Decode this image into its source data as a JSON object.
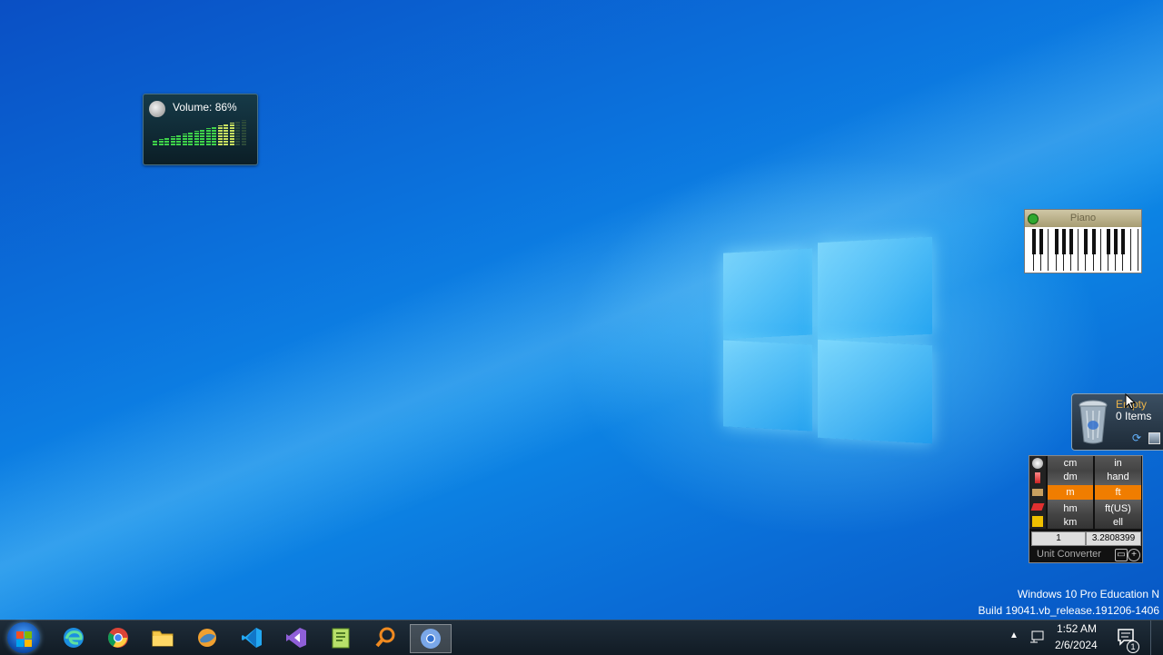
{
  "desktop": {
    "watermark": {
      "edition": "Windows 10 Pro Education N",
      "build": "Build 19041.vb_release.191206-1406"
    }
  },
  "volume_gadget": {
    "label": "Volume: 86%",
    "level_percent": 86
  },
  "piano_gadget": {
    "title": "Piano"
  },
  "recycle_bin_gadget": {
    "status": "Empty",
    "count": "0 Items"
  },
  "unit_converter": {
    "left_units": [
      "cm",
      "dm",
      "m",
      "hm",
      "km"
    ],
    "right_units": [
      "in",
      "hand",
      "ft",
      "ft(US)",
      "ell"
    ],
    "selected_left": "m",
    "selected_right": "ft",
    "input_value": "1",
    "output_value": "3.2808399",
    "footer_label": "Unit Converter"
  },
  "taskbar": {
    "apps": [
      {
        "name": "Microsoft Edge",
        "icon": "edge-icon"
      },
      {
        "name": "Google Chrome",
        "icon": "chrome-icon"
      },
      {
        "name": "File Explorer",
        "icon": "folder-icon"
      },
      {
        "name": "Browser",
        "icon": "globe-icon"
      },
      {
        "name": "Visual Studio Code",
        "icon": "vscode-icon"
      },
      {
        "name": "Visual Studio",
        "icon": "visual-studio-icon"
      },
      {
        "name": "Notepad++",
        "icon": "notepad-icon"
      },
      {
        "name": "Search",
        "icon": "magnifier-icon"
      },
      {
        "name": "Chrome (active)",
        "icon": "chrome-active-icon"
      }
    ],
    "clock": {
      "time": "1:52 AM",
      "date": "2/6/2024"
    },
    "notification_count": "1"
  },
  "colors": {
    "accent_orange": "#f07d00",
    "wallpaper_blue": "#0a6fd8",
    "taskbar": "#1a2631"
  }
}
